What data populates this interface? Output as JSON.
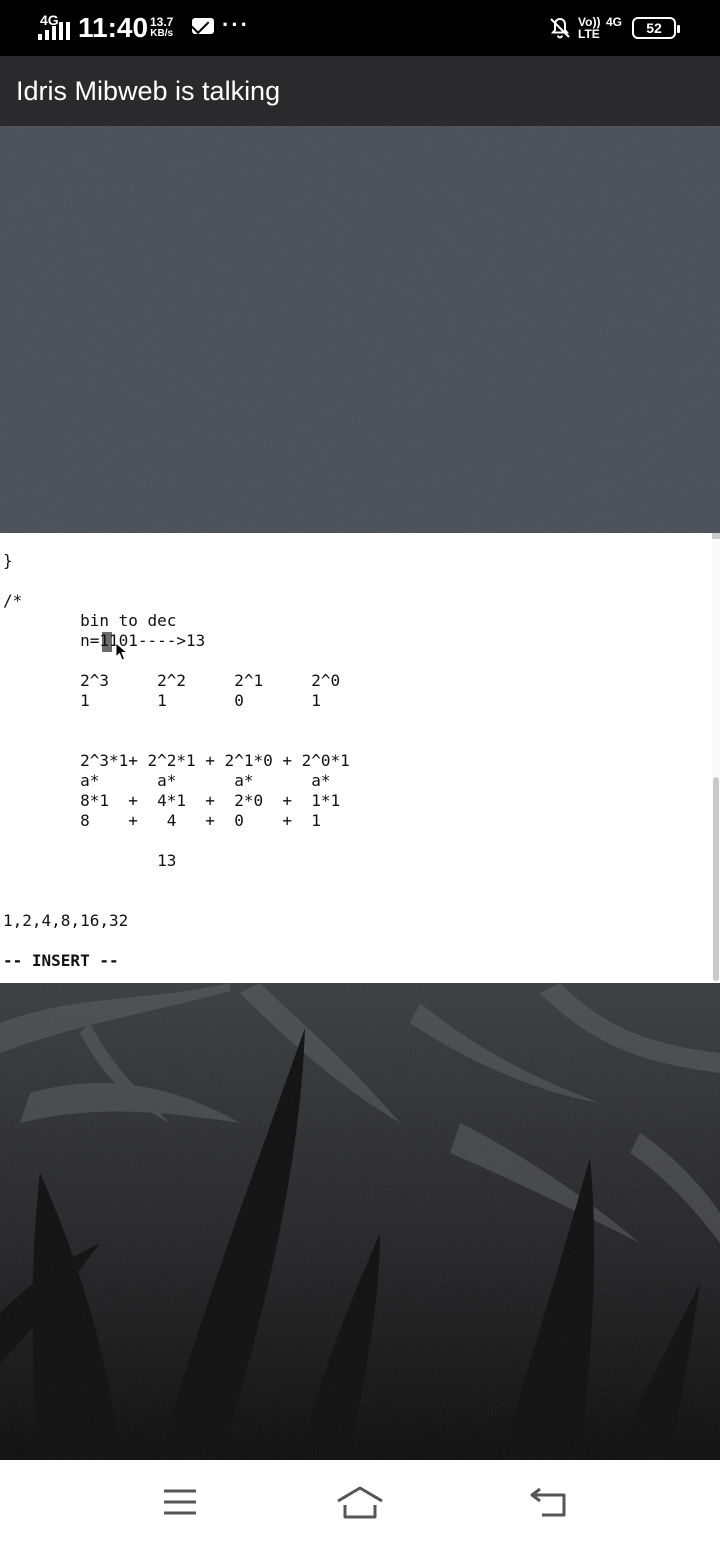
{
  "status_bar": {
    "network_type": "4G",
    "time": "11:40",
    "speed_value": "13.7",
    "speed_unit": "KB/s",
    "more": "···",
    "volte": "Vo)) LTE",
    "network_type_right": "4G",
    "battery_level": "52"
  },
  "header": {
    "title": "Idris Mibweb is talking"
  },
  "terminal": {
    "lines": [
      "}",
      "",
      "/*",
      "        bin to dec",
      "        n=1101---->13",
      "",
      "        2^3     2^2     2^1     2^0",
      "        1       1       0       1",
      "",
      "",
      "        2^3*1+ 2^2*1 + 2^1*0 + 2^0*1",
      "        a*      a*      a*      a*",
      "        8*1  +  4*1  +  2*0  +  1*1",
      "        8    +   4   +  0    +  1",
      "",
      "                13",
      "",
      "",
      "1,2,4,8,16,32",
      "",
      "-- INSERT --"
    ]
  },
  "nav": {
    "menu": "menu-icon",
    "home": "home-icon",
    "back": "back-icon"
  }
}
